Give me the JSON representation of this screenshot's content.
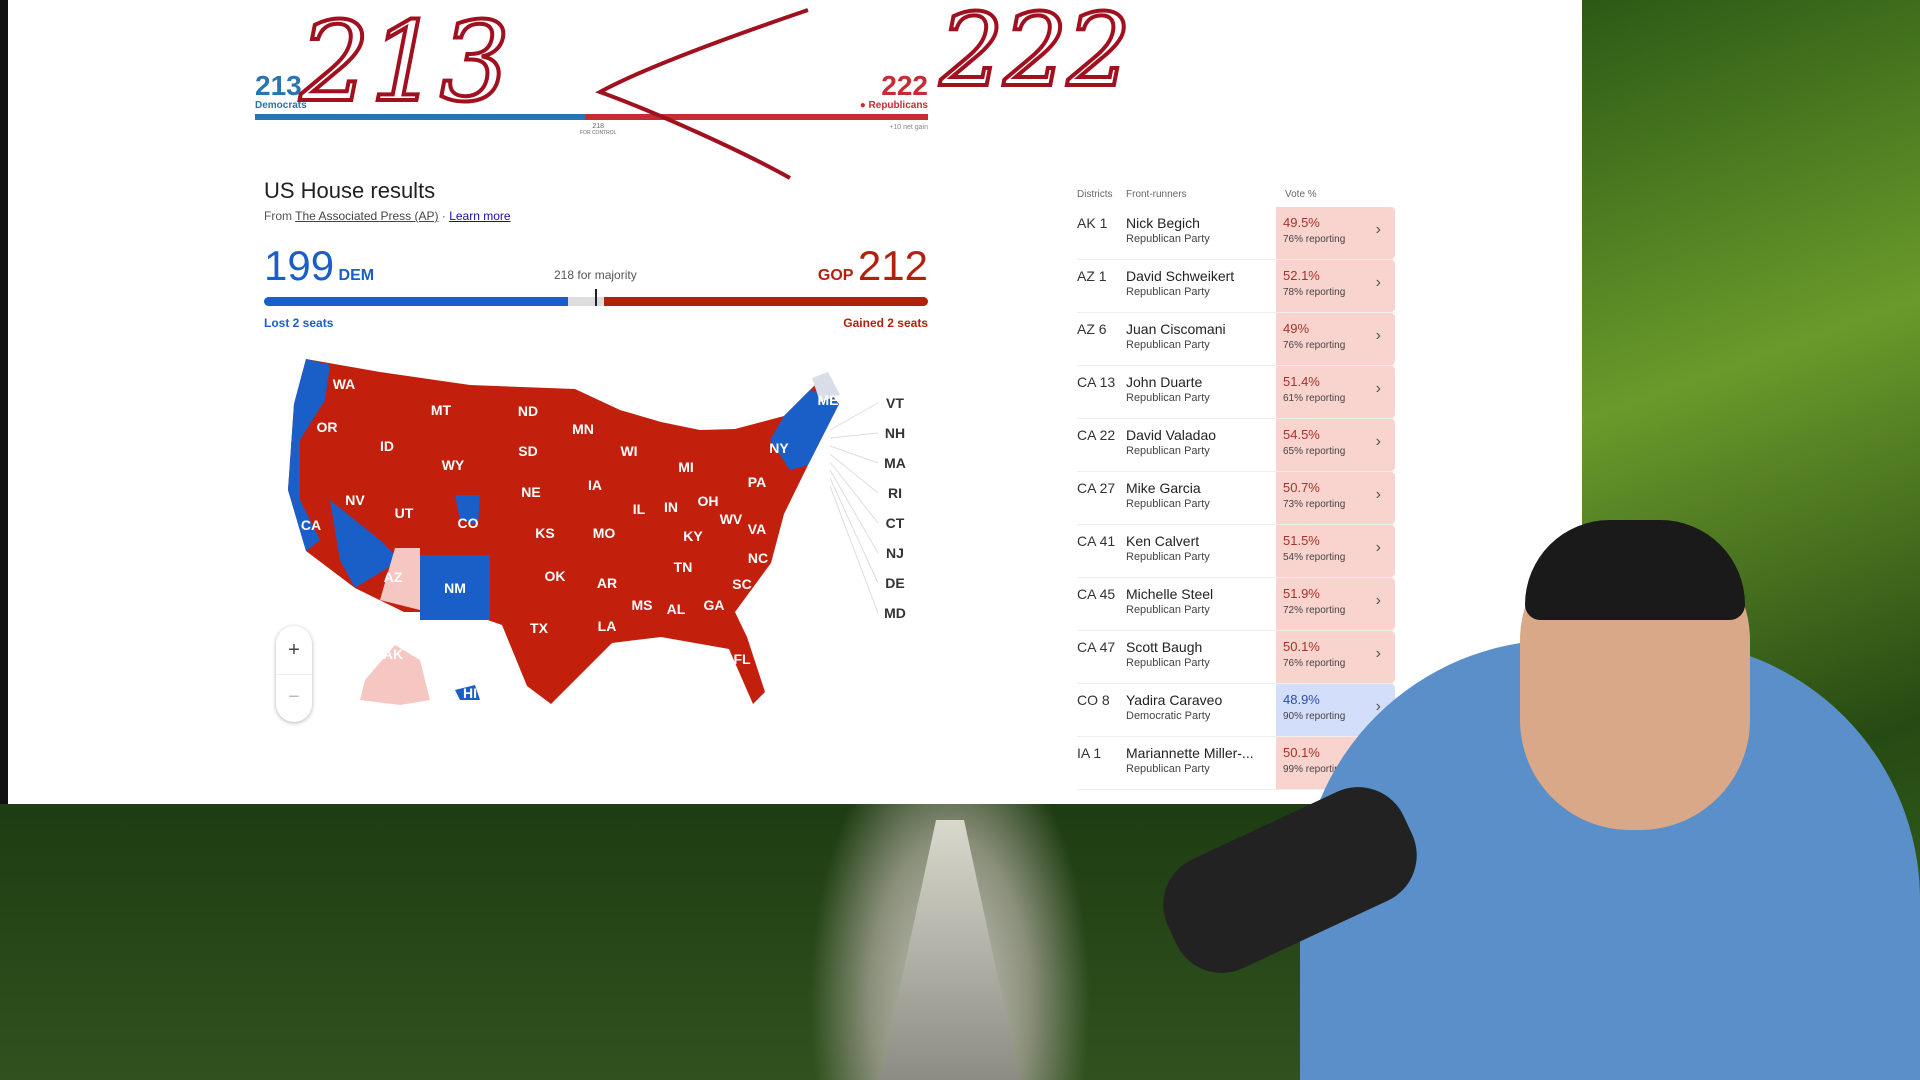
{
  "annotations": {
    "left": "213",
    "right": "222"
  },
  "summary_bar": {
    "dem_count": "213",
    "dem_label": "Democrats",
    "rep_count": "222",
    "rep_label": "Republicans",
    "control": "218",
    "control_label": "FOR CONTROL",
    "net_gain": "+10 net gain",
    "dem_share": 0.49,
    "colors": {
      "dem": "#2a74b0",
      "rep": "#c62c34"
    }
  },
  "results": {
    "title": "US House results",
    "source_prefix": "From",
    "source": "The Associated Press (AP)",
    "separator": "·",
    "learn_more": "Learn more",
    "dem_seats": "199",
    "dem_label": "DEM",
    "rep_label": "GOP",
    "rep_seats": "212",
    "majority": "218 for majority",
    "dem_change": "Lost 2 seats",
    "rep_change": "Gained 2 seats",
    "colors": {
      "dem": "#1a5fc8",
      "rep": "#b2200e"
    }
  },
  "map": {
    "states": [
      "WA",
      "OR",
      "MT",
      "ND",
      "MN",
      "ID",
      "WY",
      "SD",
      "WI",
      "MI",
      "NY",
      "ME",
      "NV",
      "UT",
      "CO",
      "NE",
      "IA",
      "IL",
      "IN",
      "OH",
      "PA",
      "CA",
      "KS",
      "MO",
      "KY",
      "WV",
      "VA",
      "NC",
      "TN",
      "OK",
      "AR",
      "SC",
      "AZ",
      "NM",
      "MS",
      "AL",
      "GA",
      "TX",
      "LA",
      "FL",
      "AK",
      "HI"
    ],
    "small_states": [
      "VT",
      "NH",
      "MA",
      "RI",
      "CT",
      "NJ",
      "DE",
      "MD"
    ],
    "zoom_in": "+",
    "zoom_out": "−"
  },
  "table": {
    "headers": {
      "district": "Districts",
      "front": "Front-runners",
      "vote": "Vote %"
    },
    "rows": [
      {
        "district": "AK 1",
        "name": "Nick Begich",
        "party": "Republican Party",
        "pct": "49.5%",
        "reporting": "76% reporting",
        "side": "r"
      },
      {
        "district": "AZ 1",
        "name": "David Schweikert",
        "party": "Republican Party",
        "pct": "52.1%",
        "reporting": "78% reporting",
        "side": "r"
      },
      {
        "district": "AZ 6",
        "name": "Juan Ciscomani",
        "party": "Republican Party",
        "pct": "49%",
        "reporting": "76% reporting",
        "side": "r"
      },
      {
        "district": "CA 13",
        "name": "John Duarte",
        "party": "Republican Party",
        "pct": "51.4%",
        "reporting": "61% reporting",
        "side": "r"
      },
      {
        "district": "CA 22",
        "name": "David Valadao",
        "party": "Republican Party",
        "pct": "54.5%",
        "reporting": "65% reporting",
        "side": "r"
      },
      {
        "district": "CA 27",
        "name": "Mike Garcia",
        "party": "Republican Party",
        "pct": "50.7%",
        "reporting": "73% reporting",
        "side": "r"
      },
      {
        "district": "CA 41",
        "name": "Ken Calvert",
        "party": "Republican Party",
        "pct": "51.5%",
        "reporting": "54% reporting",
        "side": "r"
      },
      {
        "district": "CA 45",
        "name": "Michelle Steel",
        "party": "Republican Party",
        "pct": "51.9%",
        "reporting": "72% reporting",
        "side": "r"
      },
      {
        "district": "CA 47",
        "name": "Scott Baugh",
        "party": "Republican Party",
        "pct": "50.1%",
        "reporting": "76% reporting",
        "side": "r"
      },
      {
        "district": "CO 8",
        "name": "Yadira Caraveo",
        "party": "Democratic Party",
        "pct": "48.9%",
        "reporting": "90% reporting",
        "side": "d"
      },
      {
        "district": "IA 1",
        "name": "Mariannette Miller-...",
        "party": "Republican Party",
        "pct": "50.1%",
        "reporting": "99% reporting",
        "side": "r"
      }
    ]
  }
}
